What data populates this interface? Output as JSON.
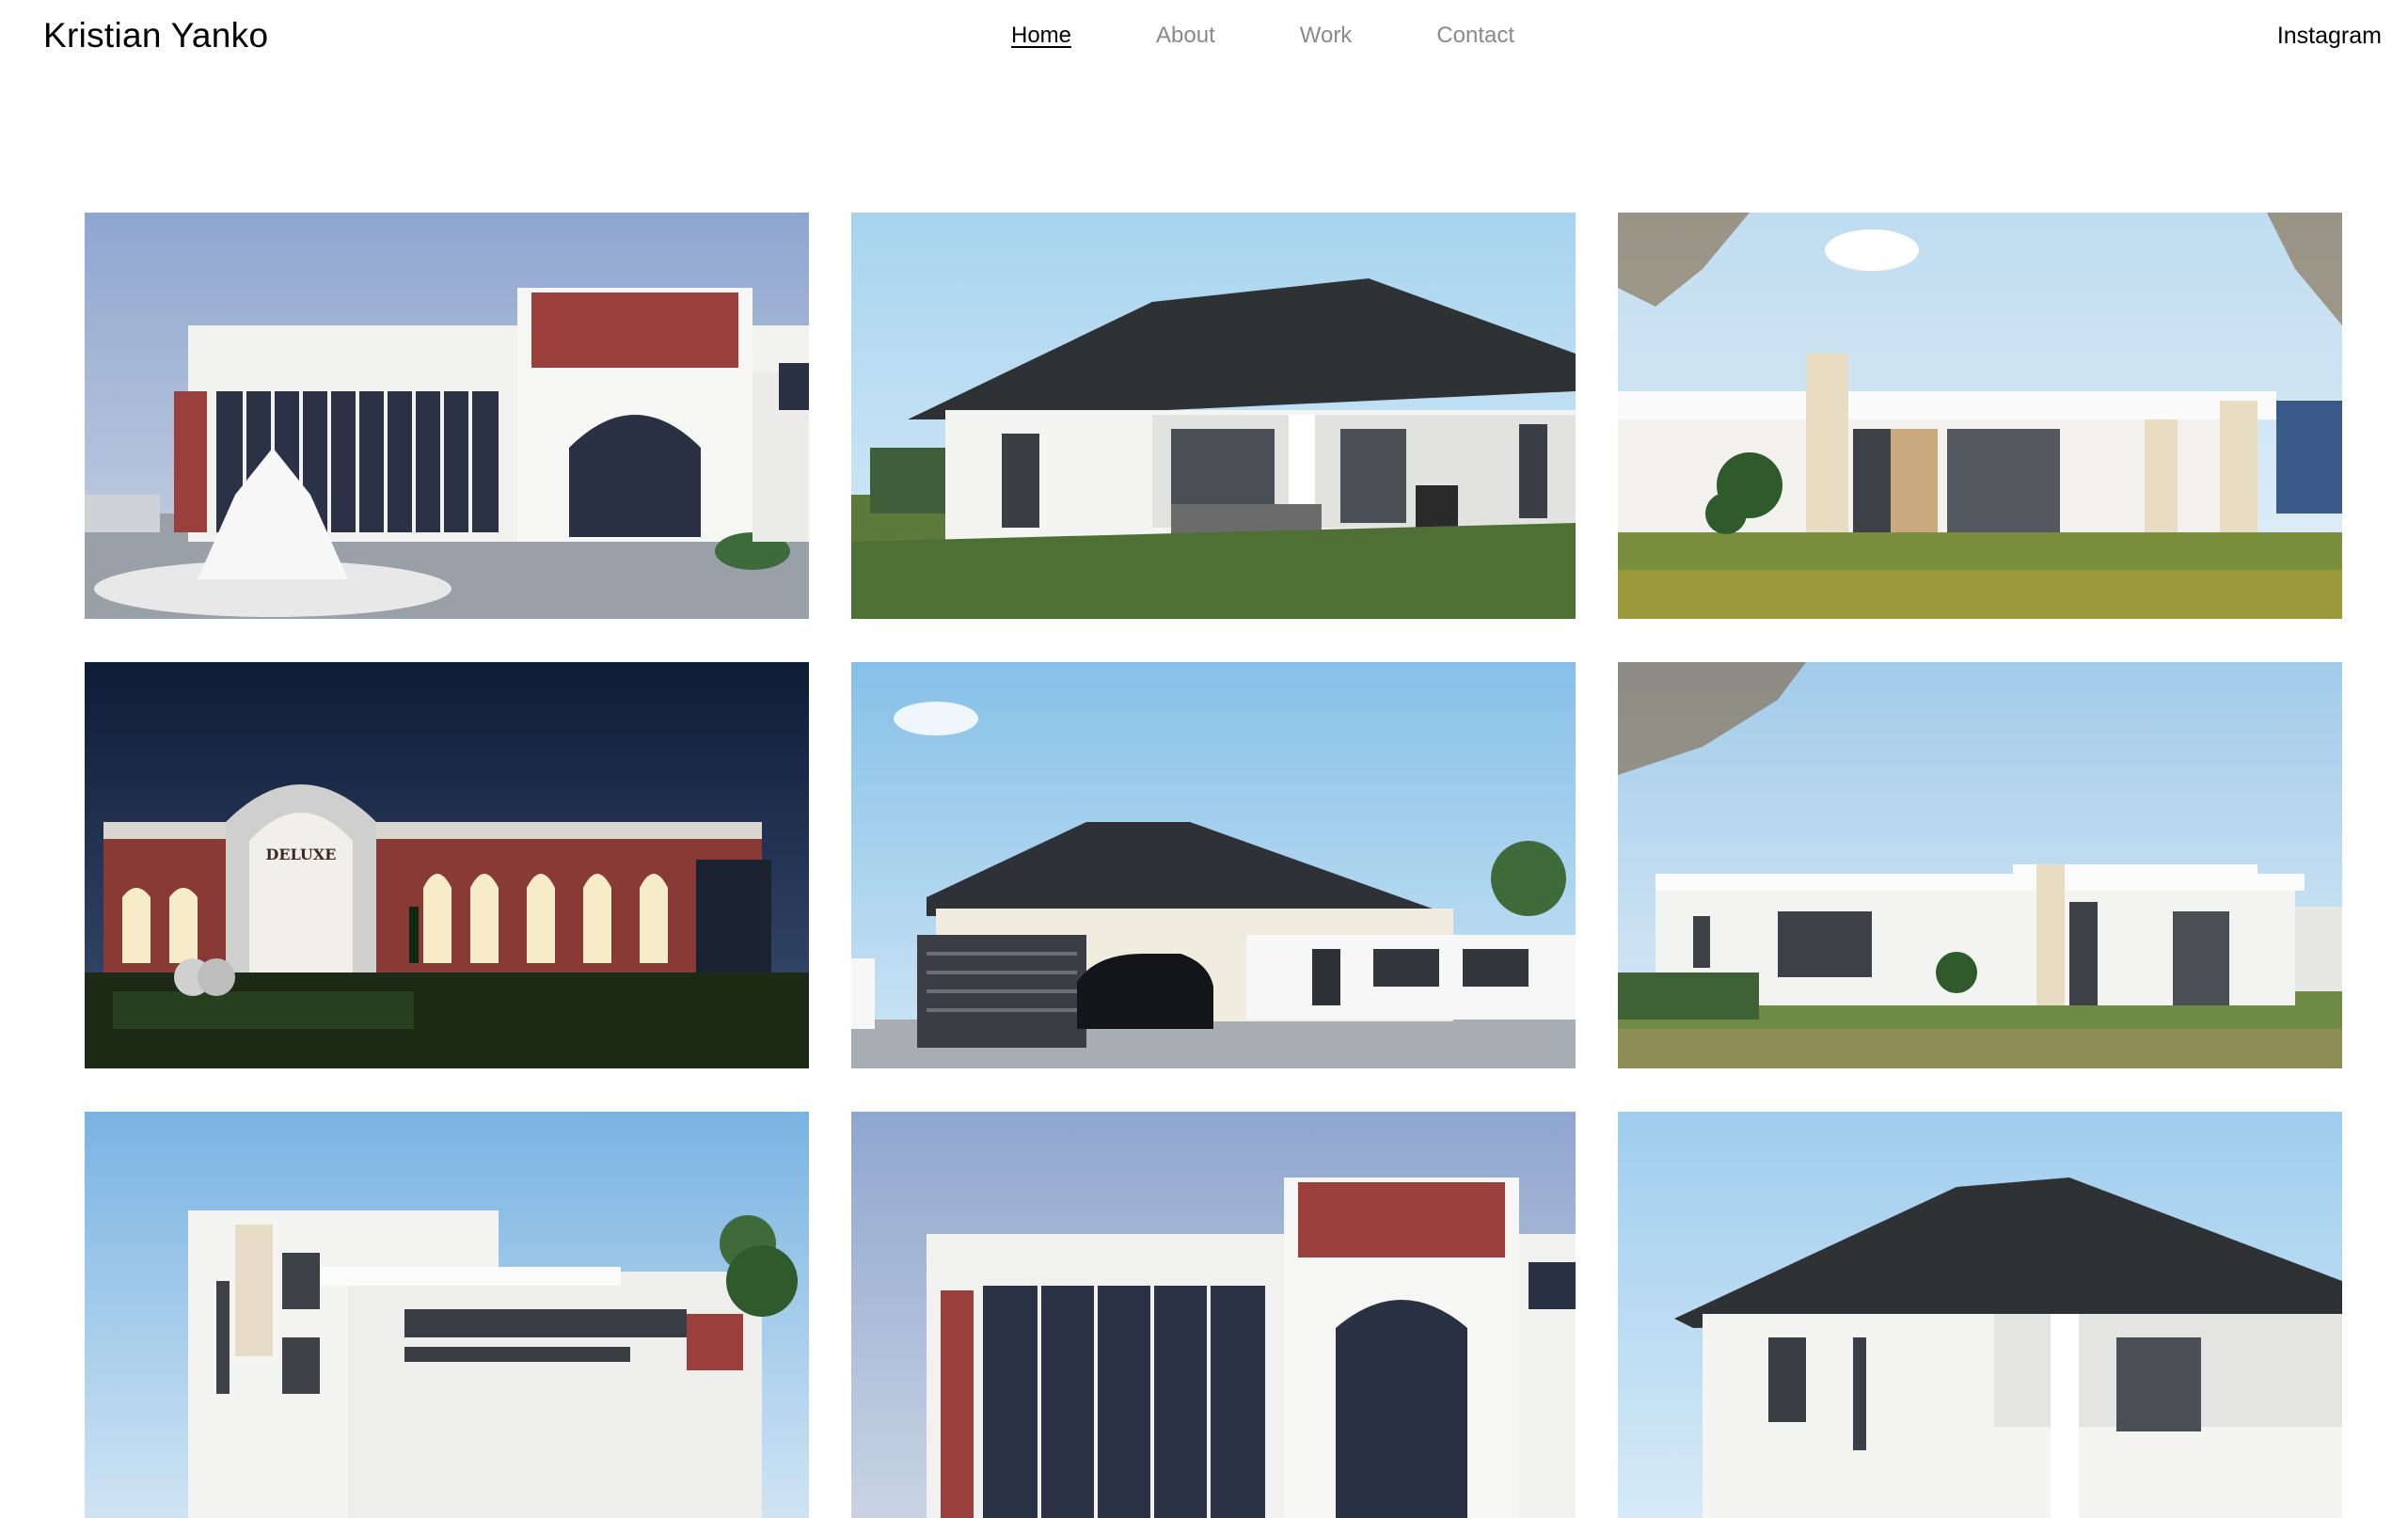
{
  "site": {
    "brand": "Kristian Yanko",
    "instagram": "Instagram"
  },
  "nav": {
    "items": [
      {
        "label": "Home",
        "active": true
      },
      {
        "label": "About",
        "active": false
      },
      {
        "label": "Work",
        "active": false
      },
      {
        "label": "Contact",
        "active": false
      }
    ]
  },
  "gallery": {
    "tiles": [
      {
        "subject": "white-classical-building-with-fountain"
      },
      {
        "subject": "single-storey-house-with-hip-roof-and-patio"
      },
      {
        "subject": "modern-flat-roof-house-with-stone-cladding"
      },
      {
        "subject": "deluxe-venue-night-render"
      },
      {
        "subject": "house-with-garage-and-dark-suv"
      },
      {
        "subject": "white-flat-roof-house-with-garage"
      },
      {
        "subject": "two-storey-modern-building-with-rooftop-terrace"
      },
      {
        "subject": "white-classical-building-facade"
      },
      {
        "subject": "hip-roof-house-with-columns"
      }
    ],
    "signage": "DELUXE"
  }
}
